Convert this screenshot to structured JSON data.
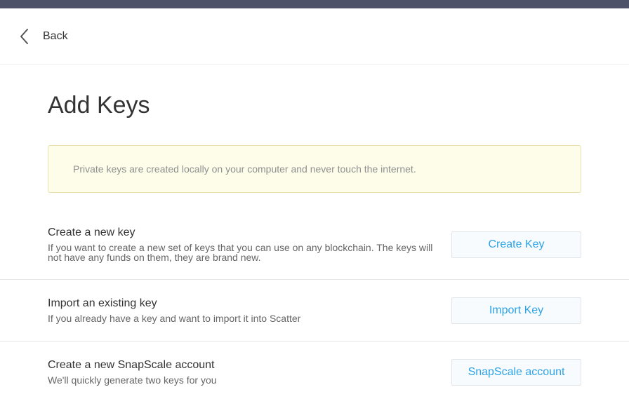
{
  "nav": {
    "back_label": "Back"
  },
  "page": {
    "title": "Add Keys"
  },
  "notice": {
    "text": "Private keys are created locally on your computer and never touch the internet."
  },
  "options": [
    {
      "title": "Create a new key",
      "description": "If you want to create a new set of keys that you can use on any blockchain. The keys will not have any funds on them, they are brand new.",
      "button": "Create Key"
    },
    {
      "title": "Import an existing key",
      "description": "If you already have a key and want to import it into Scatter",
      "button": "Import Key"
    },
    {
      "title": "Create a new SnapScale account",
      "description": "We'll quickly generate two keys for you",
      "button": "SnapScale account"
    }
  ],
  "colors": {
    "topbar": "#4e5268",
    "accent": "#2ca3e6",
    "notice_bg": "#fdfde9"
  },
  "icons": {
    "back": "chevron-left-icon"
  }
}
